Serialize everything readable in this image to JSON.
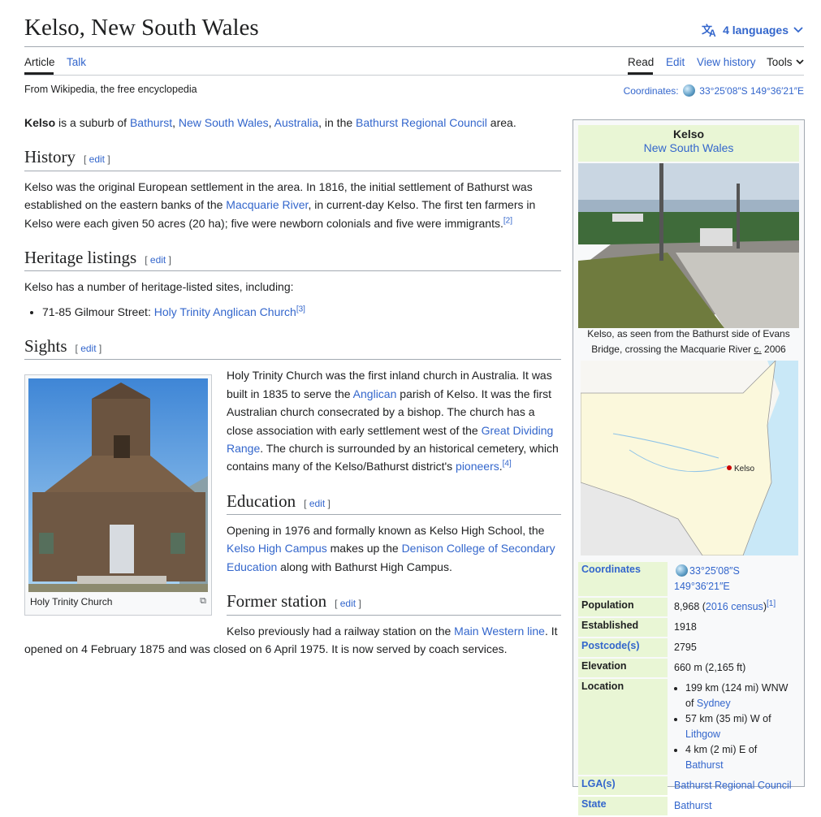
{
  "page": {
    "title": "Kelso, New South Wales",
    "languages": "4 languages",
    "tabs_left": [
      "Article",
      "Talk"
    ],
    "tabs_right": [
      "Read",
      "Edit",
      "View history",
      "Tools"
    ],
    "tagline": "From Wikipedia, the free encyclopedia",
    "coords_label": "Coordinates:",
    "coords_value": "33°25′08″S 149°36′21″E"
  },
  "intro": {
    "bold": "Kelso",
    "t1": " is a suburb of ",
    "l1": "Bathurst",
    "t2": ", ",
    "l2": "New South Wales",
    "t3": ", ",
    "l3": "Australia",
    "t4": ", in the ",
    "l4": "Bathurst Regional Council",
    "t5": " area."
  },
  "history": {
    "heading": "History",
    "edit": "edit",
    "t1": "Kelso was the original European settlement in the area. In 1816, the initial settlement of Bathurst was established on the eastern banks of the ",
    "l1": "Macquarie River",
    "t2": ", in current-day Kelso. The first ten farmers in Kelso were each given 50 acres (20 ha); five were newborn colonials and five were immigrants.",
    "ref": "[2]"
  },
  "heritage": {
    "heading": "Heritage listings",
    "edit": "edit",
    "intro": "Kelso has a number of heritage-listed sites, including:",
    "item_text": "71-85 Gilmour Street: ",
    "item_link": "Holy Trinity Anglican Church",
    "item_ref": "[3]"
  },
  "sights": {
    "heading": "Sights",
    "edit": "edit",
    "t1": "Holy Trinity Church was the first inland church in Australia. It was built in 1835 to serve the ",
    "l1": "Anglican",
    "t2": " parish of Kelso. It was the first Australian church consecrated by a bishop. The church has a close association with early settlement west of the ",
    "l2": "Great Dividing Range",
    "t3": ". The church is surrounded by an historical cemetery, which contains many of the Kelso/Bathurst district's ",
    "l3": "pioneers",
    "t4": ".",
    "ref": "[4]",
    "thumb_caption": "Holy Trinity Church"
  },
  "education": {
    "heading": "Education",
    "edit": "edit",
    "t1": "Opening in 1976 and formally known as Kelso High School, the ",
    "l1": "Kelso High Campus",
    "t2": " makes up the ",
    "l2": "Denison College of Secondary Education",
    "t3": " along with Bathurst High Campus."
  },
  "station": {
    "heading": "Former station",
    "edit": "edit",
    "t1": "Kelso previously had a railway station on the ",
    "l1": "Main Western line",
    "t2": ". It opened on 4 February 1875 and was closed on 6 April 1975. It is now served by coach services."
  },
  "infobox": {
    "title": "Kelso",
    "subtitle": "New South Wales",
    "photo_caption_1": "Kelso, as seen from the Bathurst side of Evans Bridge, crossing the Macquarie River ",
    "photo_caption_c": "c.",
    "photo_caption_2": " 2006",
    "map_marker": "Kelso",
    "rows": {
      "coordinates_label": "Coordinates",
      "coordinates_value": "33°25′08″S 149°36′21″E",
      "population_label": "Population",
      "population_value": "8,968 (",
      "population_link": "2016 census",
      "population_close": ")",
      "population_ref": "[1]",
      "established_label": "Established",
      "established_value": "1918",
      "postcode_label": "Postcode(s)",
      "postcode_value": "2795",
      "elevation_label": "Elevation",
      "elevation_value": "660 m (2,165 ft)",
      "location_label": "Location",
      "loc1_text": "199 km (124 mi) WNW of ",
      "loc1_link": "Sydney",
      "loc2_text": "57 km (35 mi) W of ",
      "loc2_link": "Lithgow",
      "loc3_text": "4 km (2 mi) E of ",
      "loc3_link": "Bathurst",
      "lga_label": "LGA(s)",
      "lga_value": "Bathurst Regional Council",
      "state_label": "State",
      "state_value": "Bathurst"
    }
  }
}
